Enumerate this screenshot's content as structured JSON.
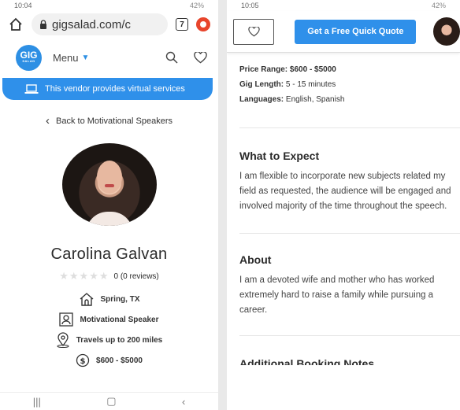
{
  "left": {
    "status": {
      "time": "10:04",
      "battery": "42%"
    },
    "browser": {
      "url": "gigsalad.com/c",
      "tab_count": "7"
    },
    "site_nav": {
      "logo_text": "GIG",
      "logo_sub": "SALAD",
      "menu_label": "Menu"
    },
    "banner": {
      "text": "This vendor provides virtual services"
    },
    "back_link": {
      "text": "Back to Motivational Speakers"
    },
    "profile": {
      "name": "Carolina Galvan",
      "rating_text": "0 (0 reviews)",
      "location": "Spring, TX",
      "category": "Motivational Speaker",
      "travel": "Travels up to 200 miles",
      "price": "$600 - $5000"
    }
  },
  "right": {
    "status": {
      "time": "10:05",
      "battery": "42%"
    },
    "topbar": {
      "quote_label": "Get a Free Quick Quote"
    },
    "details": {
      "price_label": "Price Range:",
      "price_value": "$600 - $5000",
      "length_label": "Gig Length:",
      "length_value": "5 - 15 minutes",
      "languages_label": "Languages:",
      "languages_value": "English, Spanish"
    },
    "what_to_expect": {
      "heading": "What to Expect",
      "text": "I am flexible to incorporate new subjects related my field as requested, the audience will be engaged and involved majority of the time throughout the speech."
    },
    "about": {
      "heading": "About",
      "text": "I am a devoted wife and mother who has worked extremely hard to raise a family while pursuing a career."
    },
    "next_heading": "Additional Booking Notes"
  },
  "colors": {
    "brand_blue": "#2f90ea",
    "record_red": "#e8452c"
  }
}
